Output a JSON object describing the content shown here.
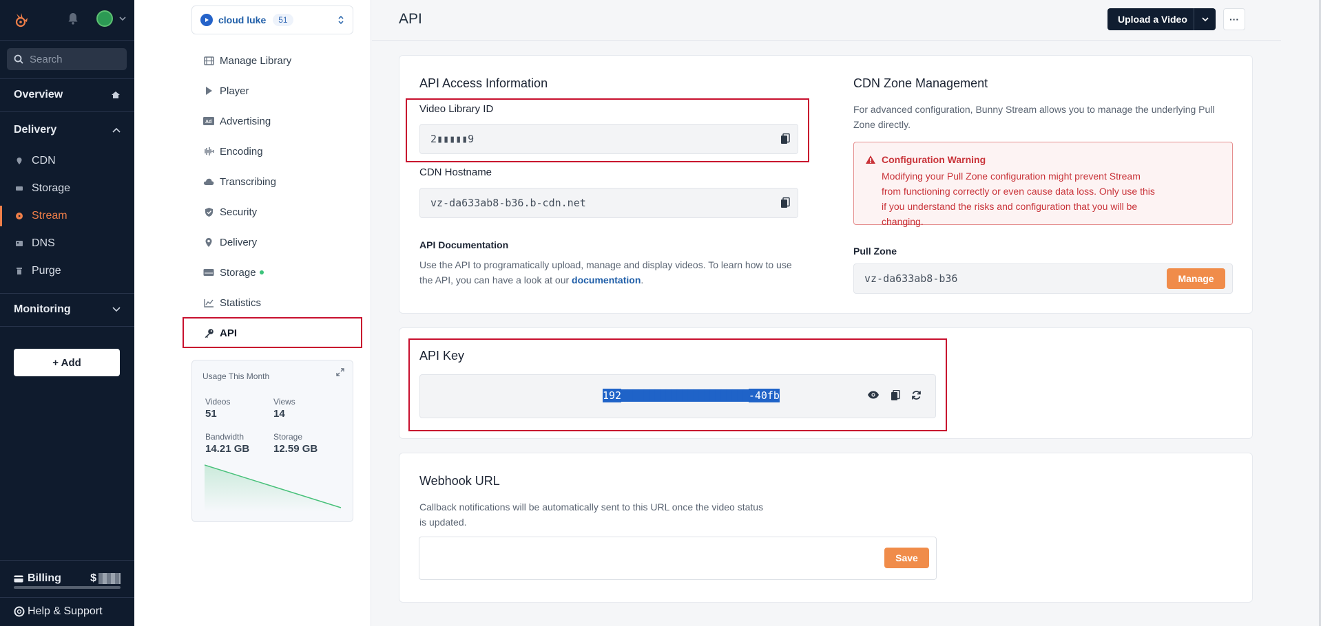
{
  "nav": {
    "search_placeholder": "Search",
    "overview": "Overview",
    "delivery": "Delivery",
    "items": [
      {
        "label": "CDN",
        "icon": "pin-icon"
      },
      {
        "label": "Storage",
        "icon": "storage-icon"
      },
      {
        "label": "Stream",
        "icon": "stream-icon",
        "active": true
      },
      {
        "label": "DNS",
        "icon": "dns-icon"
      },
      {
        "label": "Purge",
        "icon": "trash-icon"
      }
    ],
    "monitoring": "Monitoring",
    "add_label": "+ Add",
    "billing_label": "Billing",
    "billing_amount": "$",
    "help_label": "Help & Support"
  },
  "library": {
    "name": "cloud luke",
    "count": "51"
  },
  "subnav": [
    {
      "label": "Manage Library",
      "icon": "film-icon"
    },
    {
      "label": "Player",
      "icon": "play-icon"
    },
    {
      "label": "Advertising",
      "icon": "ad-icon"
    },
    {
      "label": "Encoding",
      "icon": "waveform-icon"
    },
    {
      "label": "Transcribing",
      "icon": "cloud-icon"
    },
    {
      "label": "Security",
      "icon": "shield-icon"
    },
    {
      "label": "Delivery",
      "icon": "pin-icon"
    },
    {
      "label": "Storage",
      "icon": "storage-icon"
    },
    {
      "label": "Statistics",
      "icon": "chart-icon"
    },
    {
      "label": "API",
      "icon": "key-icon",
      "selected": true
    }
  ],
  "usage": {
    "title": "Usage This Month",
    "videos_label": "Videos",
    "videos_value": "51",
    "views_label": "Views",
    "views_value": "14",
    "bandwidth_label": "Bandwidth",
    "bandwidth_value": "14.21 GB",
    "storage_label": "Storage",
    "storage_value": "12.59 GB"
  },
  "header": {
    "title": "API",
    "upload_label": "Upload a Video",
    "more_label": "···"
  },
  "api_access": {
    "title": "API Access Information",
    "library_id_label": "Video Library ID",
    "library_id_value": "2▮▮▮▮▮9",
    "cdn_hostname_label": "CDN Hostname",
    "cdn_hostname_value": "vz-da633ab8-b36.b-cdn.net",
    "doc_title": "API Documentation",
    "doc_text": "Use the API to programatically upload, manage and display videos. To learn how to use the API, you can have a look at our ",
    "doc_link": "documentation",
    "doc_end": "."
  },
  "cdn_zone": {
    "title": "CDN Zone Management",
    "description": "For advanced configuration, Bunny Stream allows you to manage the underlying Pull Zone directly.",
    "warning_title": "Configuration Warning",
    "warning_text": "Modifying your Pull Zone configuration might prevent Stream from functioning correctly or even cause data loss. Only use this if you understand the risks and configuration that you will be changing.",
    "pull_zone_label": "Pull Zone",
    "pull_zone_value": "vz-da633ab8-b36",
    "manage_label": "Manage"
  },
  "api_key": {
    "title": "API Key",
    "prefix": "192",
    "suffix": "-40fb"
  },
  "webhook": {
    "title": "Webhook URL",
    "description": "Callback notifications will be automatically sent to this URL once the video status is updated.",
    "value": "",
    "save_label": "Save"
  },
  "colors": {
    "accent": "#f08c4a",
    "nav_bg": "#0f1b2d",
    "highlight_box": "#c8102e",
    "link": "#1f5ea8"
  }
}
